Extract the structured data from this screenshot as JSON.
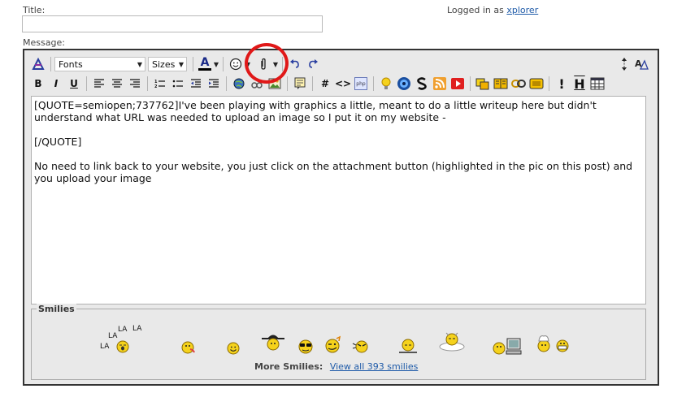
{
  "form": {
    "title_label": "Title:",
    "title_value": "",
    "message_label": "Message:",
    "logged_in_prefix": "Logged in as",
    "username": "xplorer"
  },
  "toolbar": {
    "fonts_label": "Fonts",
    "sizes_label": "Sizes",
    "text_color_glyph": "A",
    "bold": "B",
    "italic": "I",
    "underline": "U",
    "hash": "#",
    "code": "<>",
    "php": "php",
    "wrap_quote": "!",
    "html": "H",
    "icons": [
      "switch-mode-icon",
      "text-color-icon",
      "smilie-icon",
      "attachment-icon",
      "undo-icon",
      "redo-icon",
      "resize-icon",
      "remove-format-icon",
      "align-left-icon",
      "align-center-icon",
      "align-right-icon",
      "ordered-list-icon",
      "unordered-list-icon",
      "outdent-icon",
      "indent-icon",
      "insert-link-icon",
      "remove-link-icon",
      "insert-image-icon",
      "quote-icon",
      "tip-icon",
      "media-icon",
      "spoiler-icon",
      "rss-icon",
      "youtube-icon",
      "highlight-icon",
      "book-icon",
      "link-chain-icon",
      "box-icon",
      "table-icon"
    ]
  },
  "attachment_highlight_color": "#e01818",
  "textarea": {
    "line1": "[QUOTE=semiopen;737762]I've been playing with graphics a little, meant to do a little writeup here but didn't understand what URL was needed to upload an image so I put it on my website -",
    "line2": "[/QUOTE]",
    "line3": "No need to link back to your website, you just click on the attachment button (highlighted in the pic on this post) and you upload your image"
  },
  "smilies": {
    "legend": "Smilies",
    "la_text": "LA",
    "more_label": "More Smilies:",
    "view_all_link": "View all 393 smilies",
    "icons": [
      "lala-smilie-icon",
      "tongue-smilie-icon",
      "smile-smilie-icon",
      "hat-smilie-icon",
      "cool-smilie-icon",
      "wink-smilie-icon",
      "angry-smilie-icon",
      "sleep-smilie-icon",
      "cloud-smilie-icon",
      "computer-smilie-icon",
      "chef-smilie-icon"
    ]
  },
  "colors": {
    "link": "#1e5aa8",
    "editor_bg": "#e9e9e9",
    "editor_border": "#333333",
    "smilie_yellow": "#f5d21c"
  }
}
